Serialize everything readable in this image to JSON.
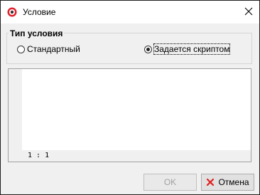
{
  "window": {
    "title": "Условие"
  },
  "group": {
    "title": "Тип условия",
    "options": [
      {
        "label": "Стандартный",
        "selected": false
      },
      {
        "label": "Задается скриптом",
        "selected": true
      }
    ]
  },
  "editor": {
    "cursor_position": "1 : 1"
  },
  "buttons": {
    "ok": "OK",
    "cancel": "Отмена"
  },
  "colors": {
    "app_icon_red": "#e0212b",
    "cancel_icon_red": "#e02020"
  }
}
